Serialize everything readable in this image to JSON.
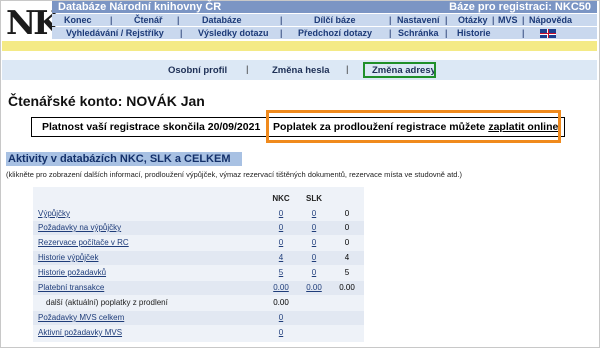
{
  "logo": {
    "text": "NK"
  },
  "header": {
    "title": "Databáze Národní knihovny ČR",
    "base": "Báze pro registraci:  NKC50"
  },
  "menu1": [
    "Konec",
    "Čtenář",
    "Databáze",
    "Dílčí báze",
    "Nastavení",
    "Otázky",
    "MVS",
    "Nápověda"
  ],
  "menu2": [
    "Vyhledávání / Rejstříky",
    "Výsledky dotazu",
    "Předchozí dotazy",
    "Schránka",
    "Historie"
  ],
  "subnav": [
    "Osobní profil",
    "Změna hesla",
    "Změna adresy"
  ],
  "account": {
    "title": "Čtenářské konto:  NOVÁK Jan"
  },
  "notice": {
    "text": "Platnost vaší registrace skončila 20/09/2021",
    "pay_text": "Poplatek za prodloužení registrace můžete",
    "pay_link": "zaplatit online"
  },
  "section": {
    "title": "Aktivity v databázích NKC, SLK a CELKEM",
    "hint": "(klikněte pro zobrazení dalších informací, prodloužení výpůjček, výmaz rezervací tištěných dokumentů, rezervace místa ve studovně atd.)"
  },
  "table": {
    "headers": [
      "NKC",
      "SLK"
    ],
    "rows": [
      {
        "label": "Výpůjčky",
        "nkc": "0",
        "slk": "0",
        "total": "0"
      },
      {
        "label": "Požadavky na výpůjčky",
        "nkc": "0",
        "slk": "0",
        "total": "0"
      },
      {
        "label": "Rezervace počítače v RC",
        "nkc": "0",
        "slk": "0",
        "total": "0"
      },
      {
        "label": "Historie výpůjček",
        "nkc": "4",
        "slk": "0",
        "total": "4"
      },
      {
        "label": "Historie požadavků",
        "nkc": "5",
        "slk": "0",
        "total": "5"
      },
      {
        "label": "Platební transakce",
        "nkc": "0.00",
        "slk": "0.00",
        "total": "0.00"
      },
      {
        "label": "další (aktuální) poplatky z prodlení",
        "nkc": "0.00",
        "slk": "",
        "total": ""
      },
      {
        "label": "Požadavky MVS celkem",
        "nkc": "0",
        "slk": "",
        "total": ""
      },
      {
        "label": "Aktivní požadavky MVS",
        "nkc": "0",
        "slk": "",
        "total": ""
      }
    ]
  },
  "colors": {
    "topbar": "#7b95c4",
    "menu": "#c9d8ee",
    "highlight_green": "#1f8f2a",
    "highlight_orange": "#f08a1c"
  },
  "icons": {
    "flag": "uk-flag-icon"
  }
}
